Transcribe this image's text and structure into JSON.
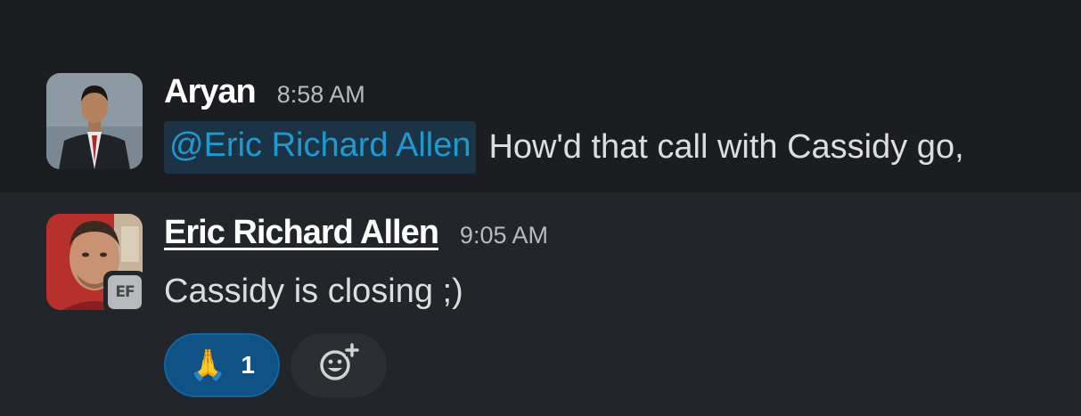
{
  "messages": [
    {
      "sender": "Aryan",
      "time": "8:58 AM",
      "mention": "@Eric Richard Allen",
      "text": "How'd that call with Cassidy go,"
    },
    {
      "sender": "Eric Richard Allen",
      "time": "9:05 AM",
      "status_badge": "EF",
      "text": "Cassidy is closing ;)",
      "reactions": [
        {
          "emoji": "🙏",
          "icon": "folded-hands-icon",
          "count": "1"
        }
      ],
      "add_reaction_icon": "add-emoji-icon"
    }
  ],
  "colors": {
    "background": "#1b1d21",
    "hover_row": "#222529",
    "mention_text": "#1d9bd1",
    "mention_bg": "#1c3345",
    "reaction_active_bg": "#0f5286"
  }
}
